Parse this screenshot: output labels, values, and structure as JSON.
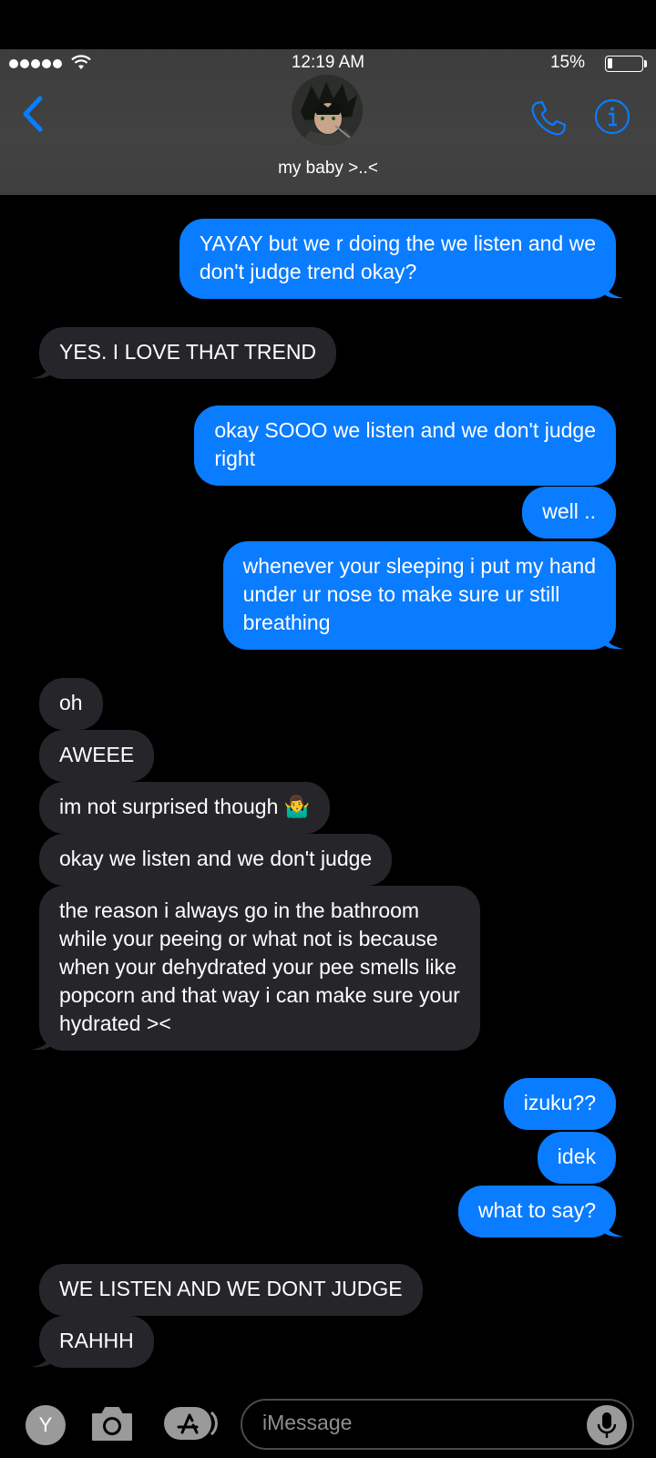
{
  "status_bar": {
    "time": "12:19 AM",
    "battery": "15%",
    "battery_level": 0.15
  },
  "header": {
    "contact_name": "my baby >..<",
    "back_icon": "chevron-left-icon",
    "call_icon": "phone-icon",
    "info_icon": "info-icon"
  },
  "colors": {
    "outgoing": "#0a7cff",
    "incoming": "#262529",
    "accent": "#0a7cff"
  },
  "messages": [
    {
      "dir": "out",
      "text": "YAYAY but we r doing the we listen and we\ndon't judge trend okay?"
    },
    {
      "dir": "in",
      "text": "YES. I LOVE THAT TREND"
    },
    {
      "dir": "out",
      "text": "okay SOOO we listen and we don't judge\nright"
    },
    {
      "dir": "out",
      "text": "well .."
    },
    {
      "dir": "out",
      "text": "whenever your sleeping i put my hand\nunder ur nose to make sure ur still\nbreathing"
    },
    {
      "dir": "in",
      "text": "oh"
    },
    {
      "dir": "in",
      "text": "AWEEE"
    },
    {
      "dir": "in",
      "text": "im not surprised though 🤷‍♂️"
    },
    {
      "dir": "in",
      "text": "okay we listen and we don't judge"
    },
    {
      "dir": "in",
      "text": "the reason i always go in the bathroom\nwhile your peeing or what not is because\nwhen your dehydrated your pee smells like\npopcorn and that way i can make sure your\nhydrated ><"
    },
    {
      "dir": "out",
      "text": "izuku??"
    },
    {
      "dir": "out",
      "text": "idek"
    },
    {
      "dir": "out",
      "text": "what to say?"
    },
    {
      "dir": "in",
      "text": "WE LISTEN AND WE DONT JUDGE"
    },
    {
      "dir": "in",
      "text": "RAHHH"
    }
  ],
  "composer": {
    "avatar_letter": "Y",
    "placeholder": "iMessage",
    "camera_icon": "camera-icon",
    "apps_icon": "app-store-icon",
    "mic_icon": "microphone-icon"
  }
}
